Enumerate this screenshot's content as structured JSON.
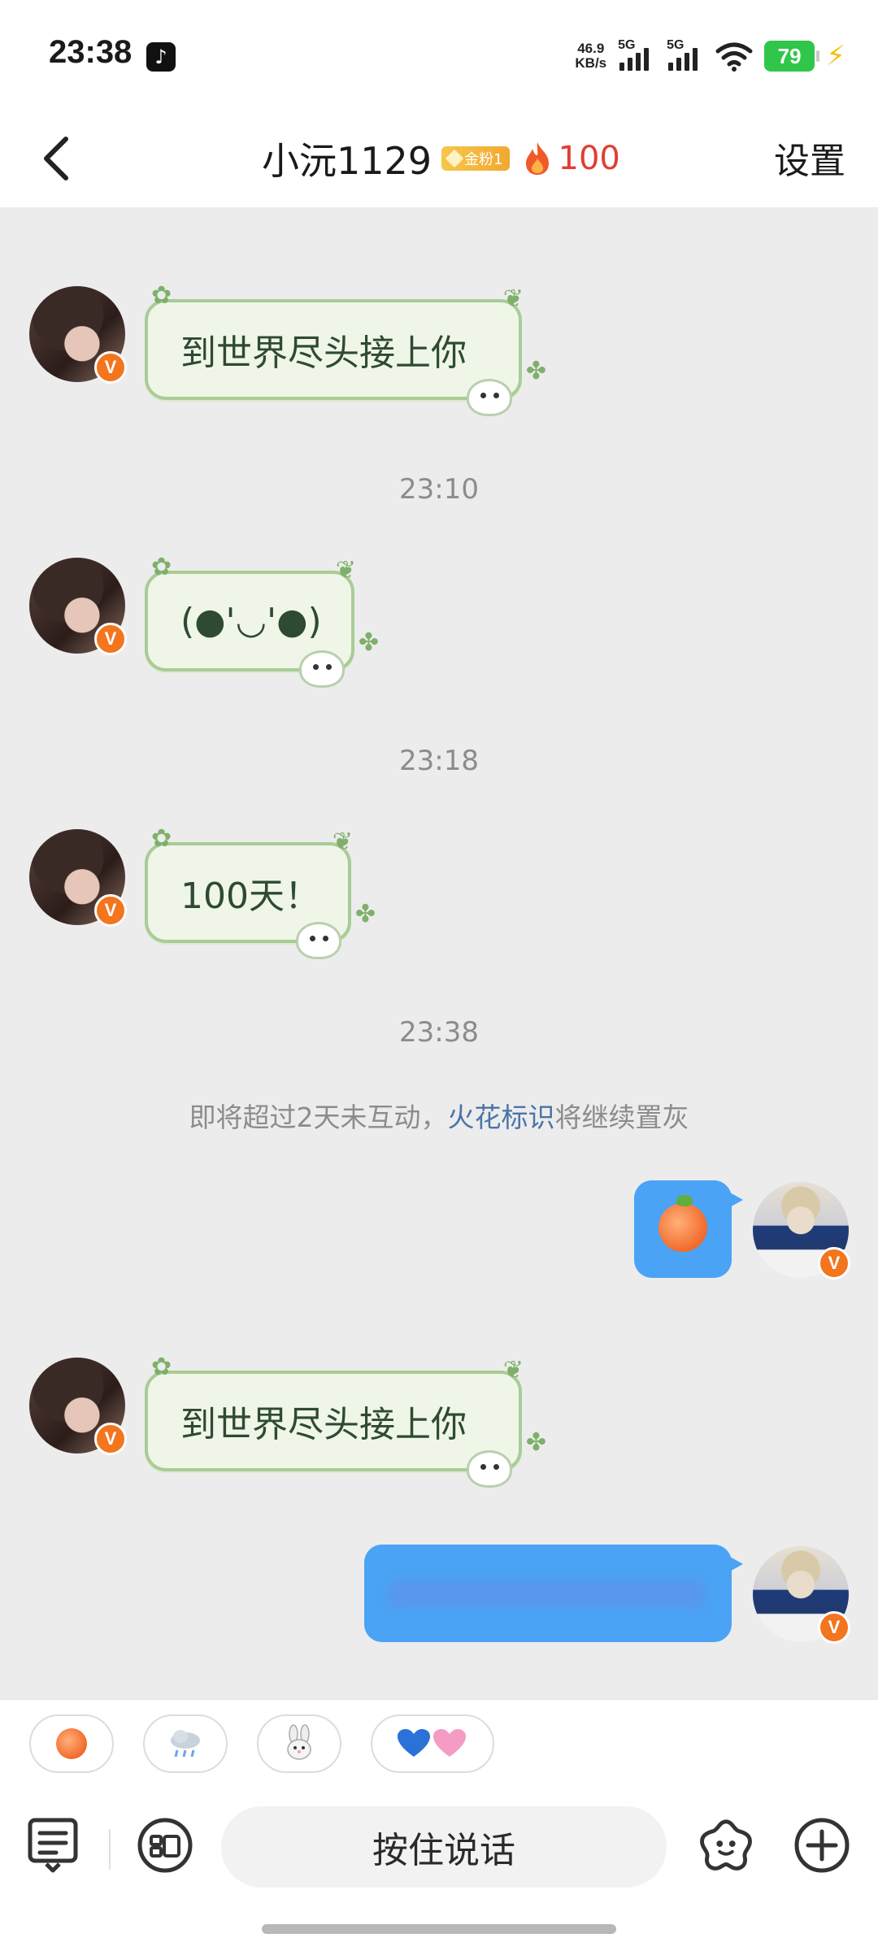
{
  "status_bar": {
    "time": "23:38",
    "app_icon": "tiktok-icon",
    "net_speed_value": "46.9",
    "net_speed_unit": "KB/s",
    "signal1_label": "5G",
    "signal2_label": "5G",
    "battery_level": "79",
    "charging": true
  },
  "header": {
    "contact_name": "小沅1129",
    "fan_badge": "金粉1",
    "streak_count": "100",
    "settings_label": "设置",
    "accent_color": "#e23d33"
  },
  "messages": {
    "m1_text": "到世界尽头接上你",
    "ts1": "23:10",
    "m2_text": "(●'◡'●)",
    "ts2": "23:18",
    "m3_text": "100天！",
    "ts3": "23:38",
    "notice_prefix": "即将超过2天未互动，",
    "notice_link": "火花标识",
    "notice_suffix": "将继续置灰",
    "m4_emoji": "peach",
    "m5_text": "到世界尽头接上你",
    "m6_text": "(blurred)"
  },
  "quick_replies": [
    {
      "icon": "peach-icon"
    },
    {
      "icon": "rain-cloud-icon"
    },
    {
      "icon": "rabbit-icon"
    },
    {
      "icon": "blue-pink-hearts-icon"
    }
  ],
  "input_bar": {
    "hold_to_talk_label": "按住说话",
    "left_icon": "notes-icon",
    "voice_icon": "voice-icon",
    "emoji_icon": "sticker-icon",
    "plus_icon": "plus-icon"
  },
  "colors": {
    "bubble_green_border": "#a9cc97",
    "bubble_green_bg": "#eff6e8",
    "my_bubble_blue": "#4aa3f5",
    "link_blue": "#4a74a8"
  }
}
